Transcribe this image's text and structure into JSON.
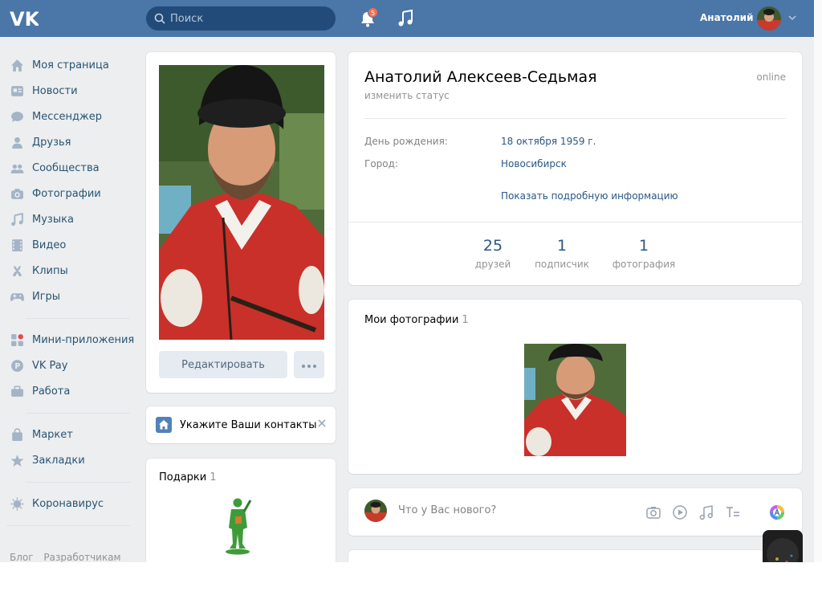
{
  "header": {
    "logo_icon": "vk-logo-icon",
    "search_placeholder": "Поиск",
    "notifications_count": "5",
    "user_name": "Анатолий"
  },
  "sidebar": {
    "groups": [
      [
        {
          "label": "Моя страница",
          "icon": "home-icon"
        },
        {
          "label": "Новости",
          "icon": "news-icon"
        },
        {
          "label": "Мессенджер",
          "icon": "messenger-icon"
        },
        {
          "label": "Друзья",
          "icon": "friends-icon"
        },
        {
          "label": "Сообщества",
          "icon": "communities-icon"
        },
        {
          "label": "Фотографии",
          "icon": "camera-icon"
        },
        {
          "label": "Музыка",
          "icon": "music-icon"
        },
        {
          "label": "Видео",
          "icon": "video-icon"
        },
        {
          "label": "Клипы",
          "icon": "clips-icon"
        },
        {
          "label": "Игры",
          "icon": "gamepad-icon"
        }
      ],
      [
        {
          "label": "Мини-приложения",
          "icon": "mini-apps-icon"
        },
        {
          "label": "VK Pay",
          "icon": "vkpay-icon"
        },
        {
          "label": "Работа",
          "icon": "briefcase-icon"
        }
      ],
      [
        {
          "label": "Маркет",
          "icon": "bag-icon"
        },
        {
          "label": "Закладки",
          "icon": "star-icon"
        }
      ],
      [
        {
          "label": "Коронавирус",
          "icon": "virus-icon"
        }
      ]
    ],
    "footer": [
      "Блог",
      "Разработчикам"
    ]
  },
  "profile": {
    "edit_label": "Редактировать",
    "contacts_label": "Укажите Ваши контакты",
    "gifts_title": "Подарки",
    "gifts_count": "1",
    "name": "Анатолий Алексеев-Седьмая",
    "status_edit": "изменить статус",
    "online": "online",
    "birthday_label": "День рождения:",
    "birthday_value": "18 октября 1959 г.",
    "city_label": "Город:",
    "city_value": "Новосибирск",
    "more_info": "Показать подробную информацию",
    "counters": [
      {
        "value": "25",
        "label": "друзей"
      },
      {
        "value": "1",
        "label": "подписчик"
      },
      {
        "value": "1",
        "label": "фотография"
      }
    ],
    "photos_title": "Мои фотографии",
    "photos_count": "1",
    "post_placeholder": "Что у Вас нового?"
  },
  "colors": {
    "header": "#4a76a8",
    "link": "#2a5885",
    "muted": "#939393",
    "background": "#edeef0"
  }
}
